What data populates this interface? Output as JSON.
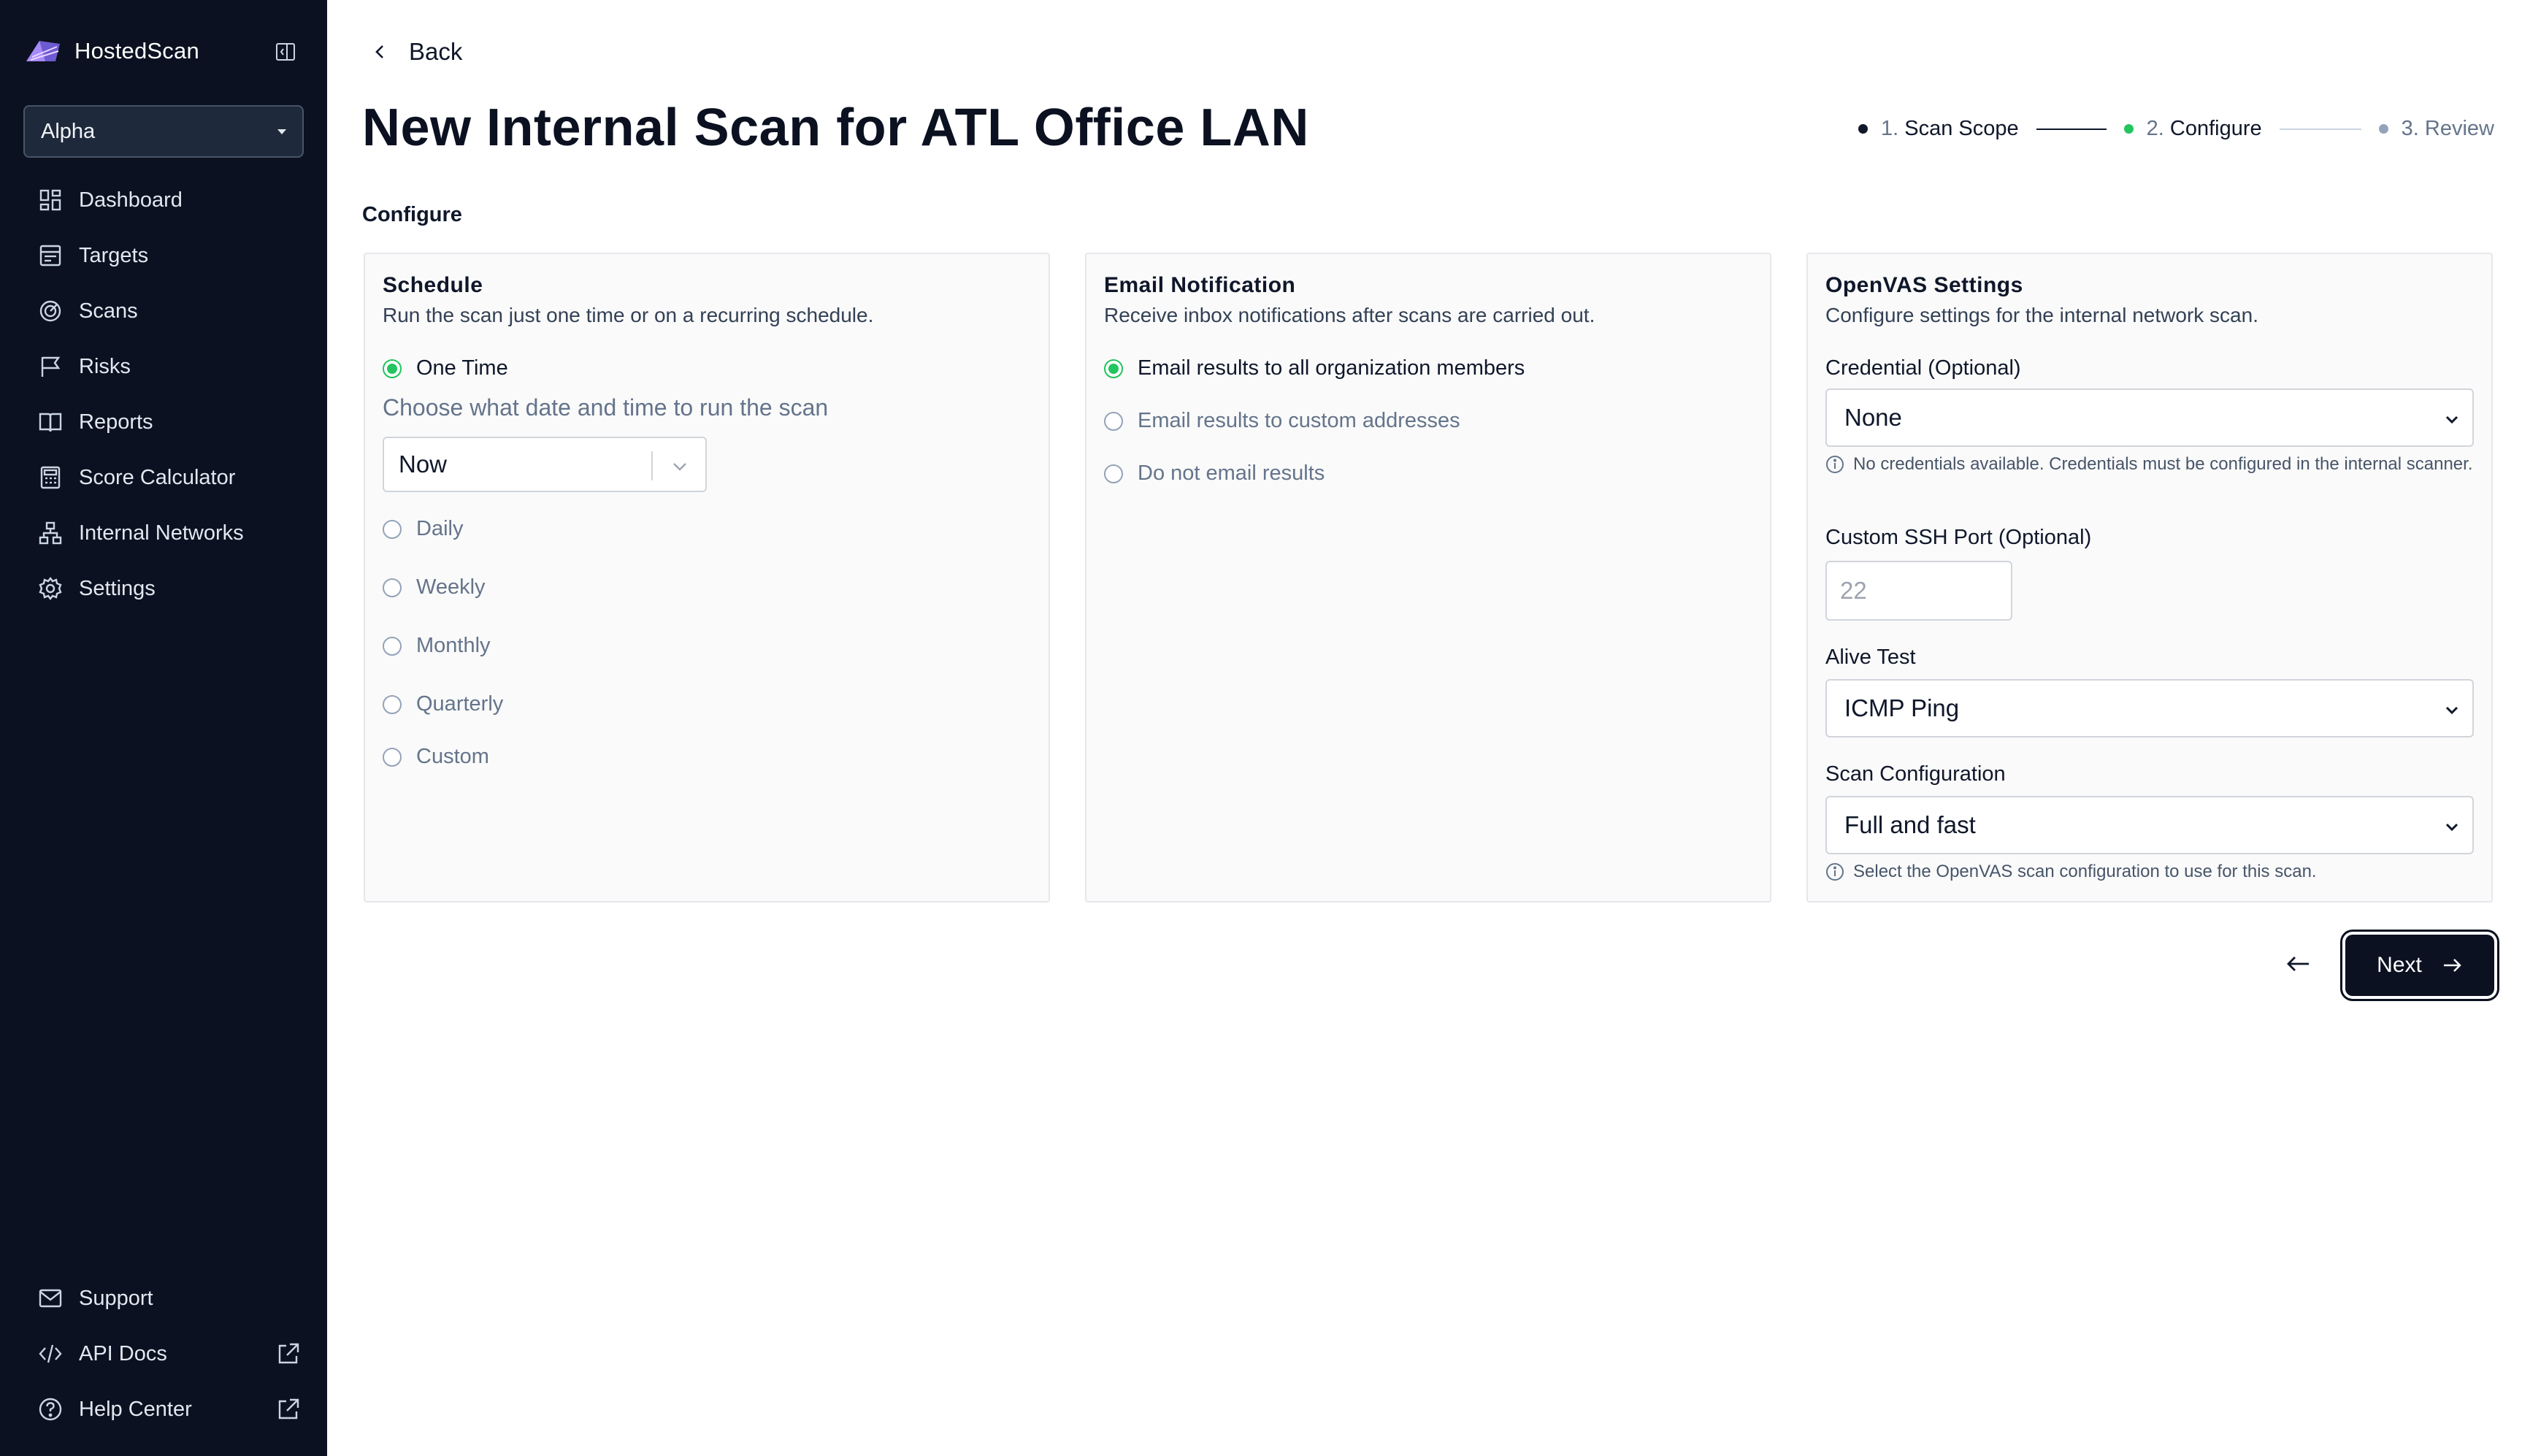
{
  "sidebar": {
    "brand": "HostedScan",
    "org": "Alpha",
    "items": [
      {
        "label": "Dashboard",
        "icon": "dashboard-icon"
      },
      {
        "label": "Targets",
        "icon": "targets-icon"
      },
      {
        "label": "Scans",
        "icon": "scans-icon"
      },
      {
        "label": "Risks",
        "icon": "flag-icon"
      },
      {
        "label": "Reports",
        "icon": "book-icon"
      },
      {
        "label": "Score Calculator",
        "icon": "calculator-icon"
      },
      {
        "label": "Internal Networks",
        "icon": "network-icon"
      },
      {
        "label": "Settings",
        "icon": "gear-icon"
      }
    ],
    "bottom": [
      {
        "label": "Support",
        "icon": "mail-icon"
      },
      {
        "label": "API Docs",
        "icon": "code-icon"
      },
      {
        "label": "Help Center",
        "icon": "help-icon"
      }
    ]
  },
  "header": {
    "back_label": "Back",
    "title": "New Internal Scan for ATL Office LAN",
    "steps": [
      {
        "num": "1.",
        "label": "Scan Scope",
        "state": "done"
      },
      {
        "num": "2.",
        "label": "Configure",
        "state": "active"
      },
      {
        "num": "3.",
        "label": "Review",
        "state": "pending"
      }
    ]
  },
  "section_label": "Configure",
  "schedule": {
    "title": "Schedule",
    "description": "Run the scan just one time or on a recurring schedule.",
    "selected": "One Time",
    "hint": "Choose what date and time to run the scan",
    "when_value": "Now",
    "options": [
      "One Time",
      "Daily",
      "Weekly",
      "Monthly",
      "Quarterly",
      "Custom"
    ]
  },
  "email": {
    "title": "Email Notification",
    "description": "Receive inbox notifications after scans are carried out.",
    "options": [
      "Email results to all organization members",
      "Email results to custom addresses",
      "Do not email results"
    ],
    "selected": "Email results to all organization members"
  },
  "openvas": {
    "title": "OpenVAS Settings",
    "description": "Configure settings for the internal network scan.",
    "credential_label": "Credential (Optional)",
    "credential_value": "None",
    "credential_info": "No credentials available. Credentials must be configured in the internal scanner.",
    "ssh_label": "Custom SSH Port (Optional)",
    "ssh_placeholder": "22",
    "alive_label": "Alive Test",
    "alive_value": "ICMP Ping",
    "config_label": "Scan Configuration",
    "config_value": "Full and fast",
    "config_info": "Select the OpenVAS scan configuration to use for this scan."
  },
  "footer": {
    "next_label": "Next"
  },
  "colors": {
    "sidebar_bg": "#0b1120",
    "accent_green": "#22c55e",
    "primary_button": "#0b1120"
  }
}
